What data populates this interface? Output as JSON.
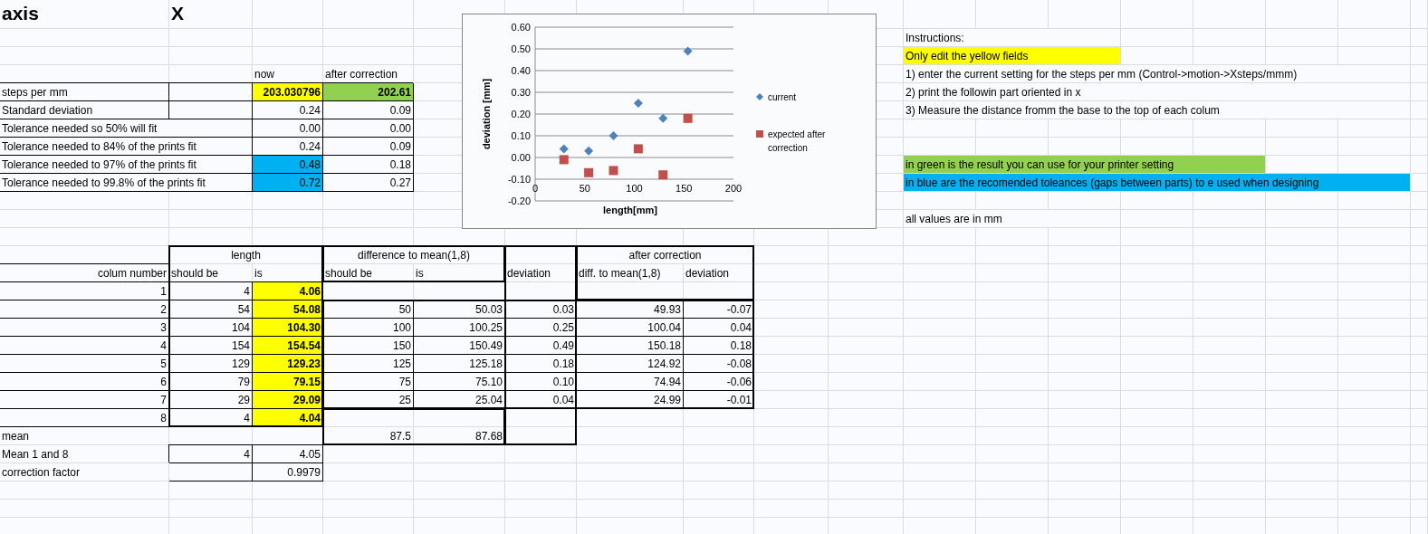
{
  "header": {
    "label": "axis",
    "value": "X"
  },
  "summary": {
    "columns": [
      "now",
      "after correction"
    ],
    "rows": [
      {
        "label": "steps per mm",
        "cells": [
          {
            "text": "203.030796",
            "color": "#ffff00",
            "bold": true
          },
          {
            "text": "202.61",
            "color": "#92d050",
            "bold": true
          }
        ]
      },
      {
        "label": "Standard deviation",
        "cells": [
          {
            "text": "0.24"
          },
          {
            "text": "0.09"
          }
        ]
      },
      {
        "label": "Tolerance needed so 50% will fit",
        "cells": [
          {
            "text": "0.00"
          },
          {
            "text": "0.00"
          }
        ]
      },
      {
        "label": "Tolerance needed to 84% of the prints fit",
        "cells": [
          {
            "text": "0.24"
          },
          {
            "text": "0.09"
          }
        ]
      },
      {
        "label": "Tolerance needed to 97% of the prints fit",
        "cells": [
          {
            "text": "0.48",
            "color": "#00b0f0"
          },
          {
            "text": "0.18"
          }
        ]
      },
      {
        "label": "Tolerance needed to 99.8% of the prints fit",
        "cells": [
          {
            "text": "0.72",
            "color": "#00b0f0"
          },
          {
            "text": "0.27"
          }
        ]
      }
    ]
  },
  "chart": {
    "chart_data": {
      "type": "scatter",
      "grid": true,
      "legend": true,
      "xlabel": "length[mm]",
      "ylabel": "deviation [mm]",
      "x": [
        54,
        104,
        154,
        129,
        79,
        29
      ],
      "series": [
        {
          "name": "current",
          "color": "#4f81bd",
          "values": [
            0.03,
            0.25,
            0.49,
            0.18,
            0.1,
            0.04
          ]
        },
        {
          "name": "expected after correction",
          "color": "#c0504d",
          "values": [
            -0.07,
            0.04,
            0.18,
            -0.08,
            -0.06,
            -0.01
          ]
        }
      ],
      "xlim": [
        0,
        200
      ],
      "ylim": [
        -0.2,
        0.6
      ],
      "xticks": [
        0,
        50,
        100,
        150,
        200
      ],
      "yticks": [
        {
          "value": -0.2,
          "label": "-0.20"
        },
        {
          "value": -0.1,
          "label": "-0.10"
        },
        {
          "value": 0,
          "label": "0.00"
        },
        {
          "value": 0.1,
          "label": "0.10"
        },
        {
          "value": 0.2,
          "label": "0.20"
        },
        {
          "value": 0.3,
          "label": "0.30"
        },
        {
          "value": 0.4,
          "label": "0.40"
        },
        {
          "value": 0.5,
          "label": "0.50"
        },
        {
          "value": 0.6,
          "label": "0.60"
        }
      ]
    }
  },
  "instructions": {
    "title": "Instructions:",
    "steps": [
      {
        "text": "Only edit the yellow fields",
        "color": "#ffff00"
      },
      {
        "text": "1) enter the current setting for the steps per mm (Control->motion->Xsteps/mmm)"
      },
      {
        "text": "2) print the followin part oriented in x"
      },
      {
        "text": "3) Measure the distance fromm the base to the top of each colum"
      }
    ],
    "notes": [
      {
        "text": "in green is the result you can use for your printer setting",
        "color": "#92d050"
      },
      {
        "text": "in blue are the recomended toleances (gaps between parts) to e used when designing",
        "color": "#00b0f0"
      }
    ],
    "footnote": "all values are in mm"
  },
  "measurements": {
    "groups": [
      "length",
      "difference to mean(1,8)",
      "after correction"
    ],
    "columns": [
      "colum number",
      "should be",
      "is",
      "should be",
      "is",
      "deviation",
      "diff. to mean(1,8)",
      "deviation"
    ],
    "rows": [
      {
        "number": "1",
        "should_be": "4",
        "is": {
          "text": "4.06",
          "color": "#ffff00",
          "bold": true
        }
      },
      {
        "number": "2",
        "should_be": "54",
        "is": {
          "text": "54.08",
          "color": "#ffff00",
          "bold": true
        },
        "diff_should_be": "50",
        "diff_is": "50.03",
        "deviation": "0.03",
        "corrected_diff": "49.93",
        "corrected_deviation": "-0.07"
      },
      {
        "number": "3",
        "should_be": "104",
        "is": {
          "text": "104.30",
          "color": "#ffff00",
          "bold": true
        },
        "diff_should_be": "100",
        "diff_is": "100.25",
        "deviation": "0.25",
        "corrected_diff": "100.04",
        "corrected_deviation": "0.04"
      },
      {
        "number": "4",
        "should_be": "154",
        "is": {
          "text": "154.54",
          "color": "#ffff00",
          "bold": true
        },
        "diff_should_be": "150",
        "diff_is": "150.49",
        "deviation": "0.49",
        "corrected_diff": "150.18",
        "corrected_deviation": "0.18"
      },
      {
        "number": "5",
        "should_be": "129",
        "is": {
          "text": "129.23",
          "color": "#ffff00",
          "bold": true
        },
        "diff_should_be": "125",
        "diff_is": "125.18",
        "deviation": "0.18",
        "corrected_diff": "124.92",
        "corrected_deviation": "-0.08"
      },
      {
        "number": "6",
        "should_be": "79",
        "is": {
          "text": "79.15",
          "color": "#ffff00",
          "bold": true
        },
        "diff_should_be": "75",
        "diff_is": "75.10",
        "deviation": "0.10",
        "corrected_diff": "74.94",
        "corrected_deviation": "-0.06"
      },
      {
        "number": "7",
        "should_be": "29",
        "is": {
          "text": "29.09",
          "color": "#ffff00",
          "bold": true
        },
        "diff_should_be": "25",
        "diff_is": "25.04",
        "deviation": "0.04",
        "corrected_diff": "24.99",
        "corrected_deviation": "-0.01"
      },
      {
        "number": "8",
        "should_be": "4",
        "is": {
          "text": "4.04",
          "color": "#ffff00",
          "bold": true
        }
      }
    ],
    "totals": [
      {
        "label": "mean",
        "diff_should_be": "87.5",
        "diff_is": "87.68"
      },
      {
        "label": "Mean 1 and 8",
        "should_be": "4",
        "is": {
          "text": "4.05"
        }
      },
      {
        "label": "correction factor",
        "is": {
          "text": "0.9979"
        }
      }
    ]
  }
}
